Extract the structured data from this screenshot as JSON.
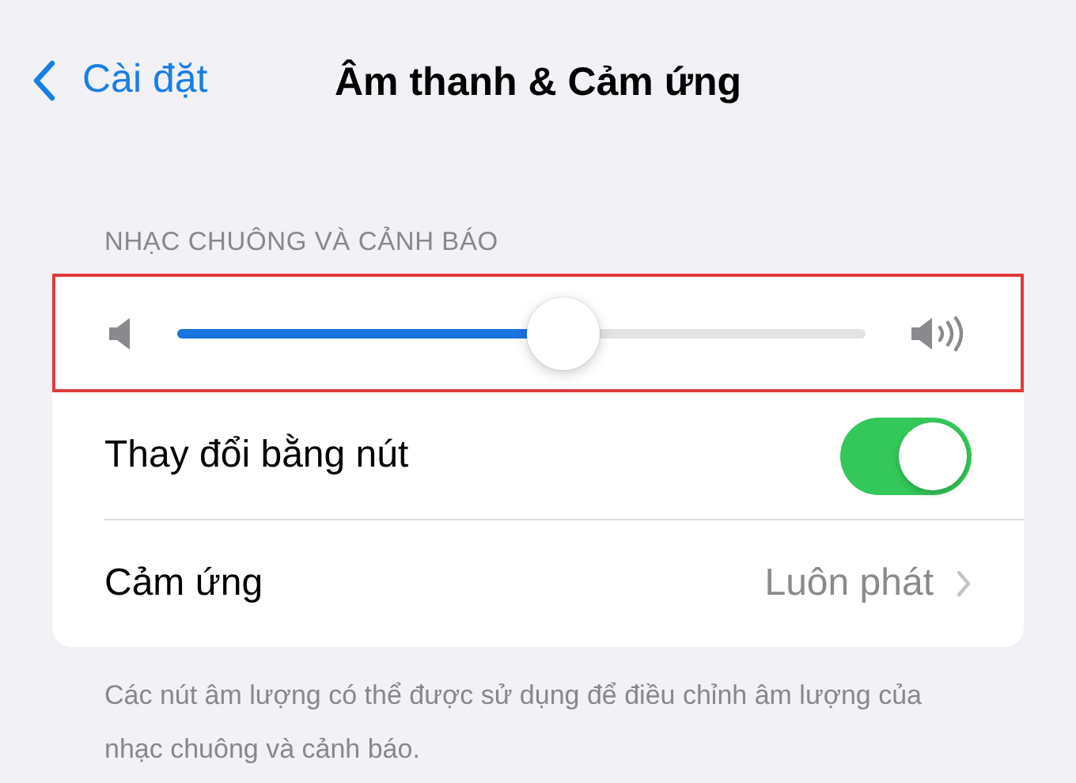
{
  "nav": {
    "back_label": "Cài đặt",
    "title": "Âm thanh & Cảm ứng"
  },
  "section": {
    "header": "NHẠC CHUÔNG VÀ CẢNH BÁO",
    "slider": {
      "level": 0.56,
      "highlighted": true
    },
    "rows": [
      {
        "kind": "toggle",
        "label": "Thay đổi bằng nút",
        "on": true
      },
      {
        "kind": "link",
        "label": "Cảm ứng",
        "value": "Luôn phát"
      }
    ],
    "footer": "Các nút âm lượng có thể được sử dụng để điều chỉnh âm lượng của nhạc chuông và cảnh báo."
  }
}
